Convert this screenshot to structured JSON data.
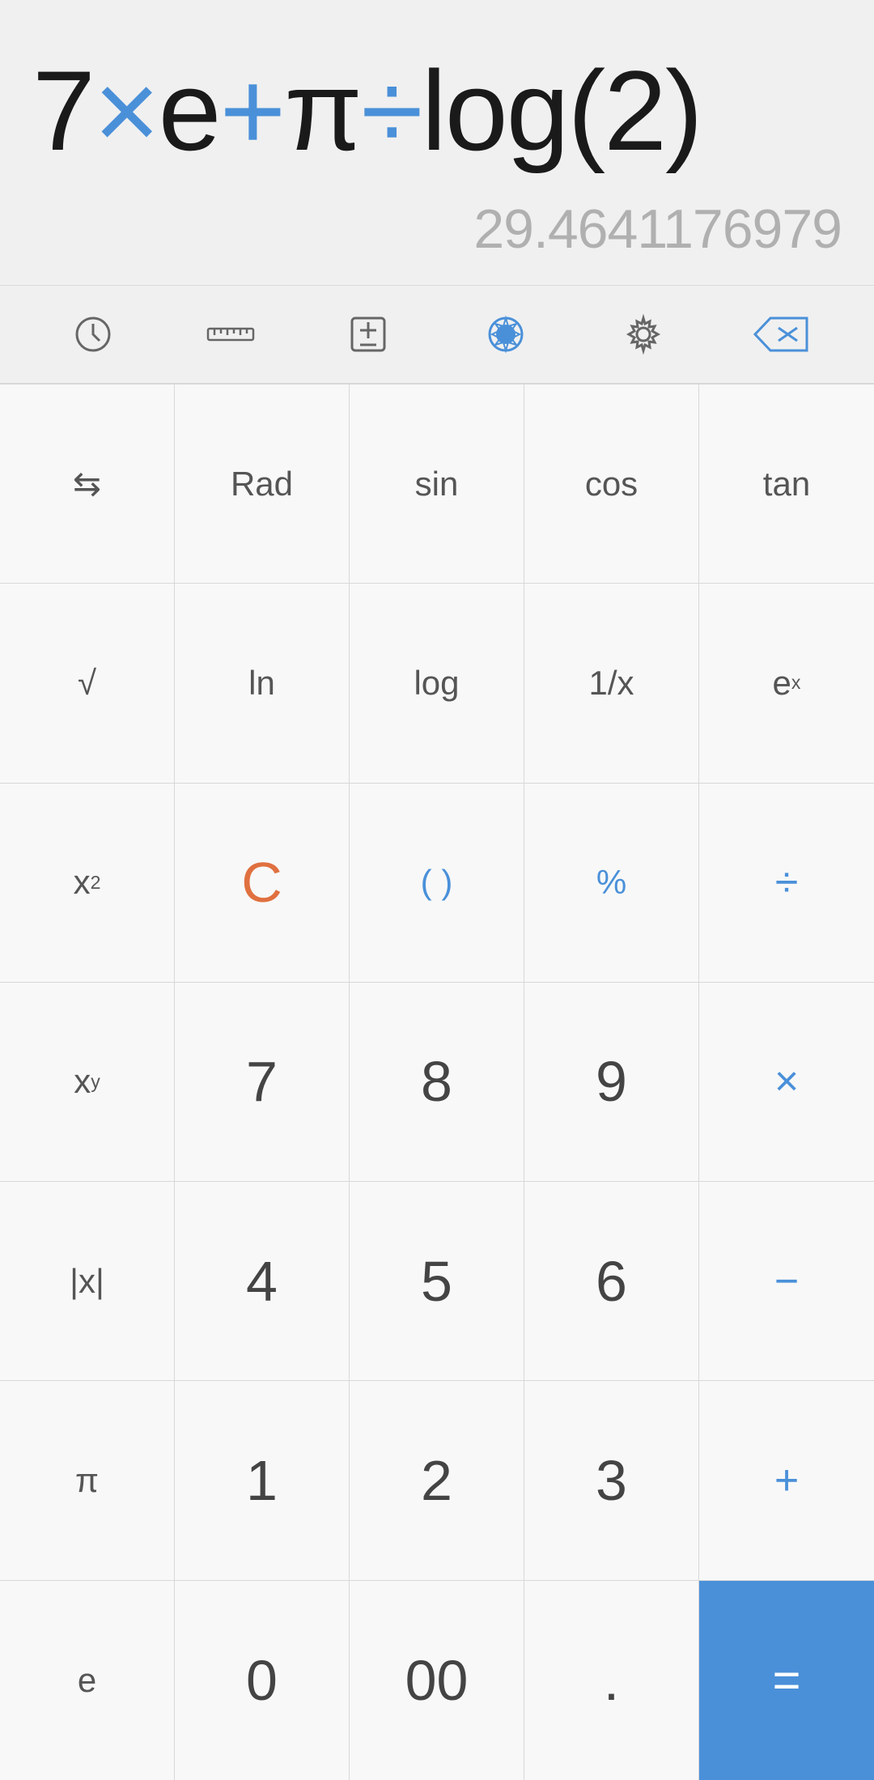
{
  "display": {
    "expression": {
      "parts": [
        {
          "text": "7",
          "type": "normal"
        },
        {
          "text": "×",
          "type": "blue"
        },
        {
          "text": "e",
          "type": "normal"
        },
        {
          "text": "+",
          "type": "blue"
        },
        {
          "text": "π",
          "type": "normal"
        },
        {
          "text": "÷",
          "type": "blue"
        },
        {
          "text": "log(2)",
          "type": "normal"
        }
      ]
    },
    "result": "29.4641176979"
  },
  "toolbar": {
    "history_label": "⏱",
    "ruler_label": "━━━",
    "plusminus_label": "±",
    "theme_label": "⚙",
    "settings_label": "⚙",
    "backspace_label": "⌫"
  },
  "keypad": {
    "rows": [
      [
        {
          "label": "⇆",
          "type": "normal",
          "name": "inverse"
        },
        {
          "label": "Rad",
          "type": "normal",
          "name": "rad"
        },
        {
          "label": "sin",
          "type": "normal",
          "name": "sin"
        },
        {
          "label": "cos",
          "type": "normal",
          "name": "cos"
        },
        {
          "label": "tan",
          "type": "normal",
          "name": "tan"
        }
      ],
      [
        {
          "label": "√",
          "type": "normal",
          "name": "sqrt"
        },
        {
          "label": "ln",
          "type": "normal",
          "name": "ln"
        },
        {
          "label": "log",
          "type": "normal",
          "name": "log"
        },
        {
          "label": "1/x",
          "type": "normal",
          "name": "reciprocal"
        },
        {
          "label": "eˣ",
          "type": "normal",
          "name": "exp"
        }
      ],
      [
        {
          "label": "x²",
          "type": "normal",
          "name": "square"
        },
        {
          "label": "C",
          "type": "orange",
          "name": "clear"
        },
        {
          "label": "( )",
          "type": "blue",
          "name": "parentheses"
        },
        {
          "label": "%",
          "type": "blue",
          "name": "percent"
        },
        {
          "label": "÷",
          "type": "blue",
          "name": "divide"
        }
      ],
      [
        {
          "label": "xʸ",
          "type": "normal",
          "name": "power"
        },
        {
          "label": "7",
          "type": "dark",
          "name": "seven"
        },
        {
          "label": "8",
          "type": "dark",
          "name": "eight"
        },
        {
          "label": "9",
          "type": "dark",
          "name": "nine"
        },
        {
          "label": "×",
          "type": "blue",
          "name": "multiply"
        }
      ],
      [
        {
          "label": "|x|",
          "type": "normal",
          "name": "abs"
        },
        {
          "label": "4",
          "type": "dark",
          "name": "four"
        },
        {
          "label": "5",
          "type": "dark",
          "name": "five"
        },
        {
          "label": "6",
          "type": "dark",
          "name": "six"
        },
        {
          "label": "−",
          "type": "blue",
          "name": "subtract"
        }
      ],
      [
        {
          "label": "π",
          "type": "normal",
          "name": "pi"
        },
        {
          "label": "1",
          "type": "dark",
          "name": "one"
        },
        {
          "label": "2",
          "type": "dark",
          "name": "two"
        },
        {
          "label": "3",
          "type": "dark",
          "name": "three"
        },
        {
          "label": "+",
          "type": "blue",
          "name": "add"
        }
      ],
      [
        {
          "label": "e",
          "type": "normal",
          "name": "euler"
        },
        {
          "label": "0",
          "type": "dark",
          "name": "zero"
        },
        {
          "label": "00",
          "type": "dark",
          "name": "double-zero"
        },
        {
          "label": ".",
          "type": "dark",
          "name": "decimal"
        },
        {
          "label": "=",
          "type": "equals",
          "name": "equals"
        }
      ]
    ]
  }
}
